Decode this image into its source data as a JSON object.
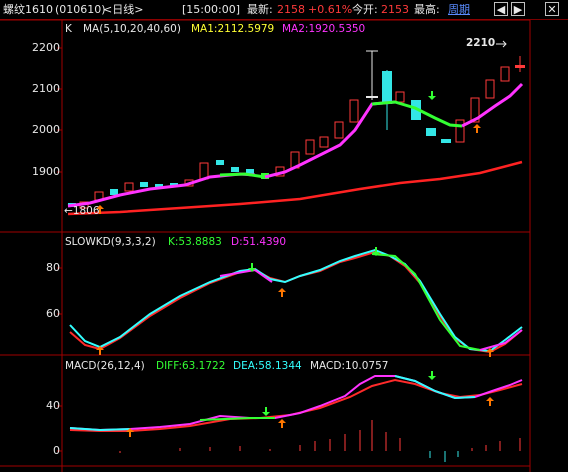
{
  "titlebar": {
    "symbol": "螺纹1610",
    "code": "(010610)",
    "period": "<日线>",
    "time": "[15:00:00]",
    "latest_label": "最新:",
    "latest_value": "2158",
    "change": "+0.61%",
    "open_label": "今开:",
    "open_value": "2153",
    "high_label": "最高:",
    "cycle_link": "周期",
    "buttons": [
      "◀",
      "▶",
      "✕"
    ]
  },
  "kline": {
    "label_k": "K",
    "ma_header": "MA(5,10,20,40,60)",
    "ma1": "MA1:2112.5979",
    "ma2": "MA2:1920.5350",
    "y_ticks": [
      "2200",
      "2100",
      "2000",
      "1900"
    ],
    "high_marker": "2210",
    "low_marker": "1806"
  },
  "kd": {
    "header": "SLOWKD(9,3,3,2)",
    "k": "K:53.8883",
    "d": "D:51.4390",
    "y_ticks": [
      "80",
      "60"
    ]
  },
  "macd": {
    "header": "MACD(26,12,4)",
    "diff": "DIFF:63.1722",
    "dea": "DEA:58.1344",
    "macd": "MACD:10.0757",
    "y_ticks": [
      "40",
      "0"
    ]
  },
  "colors": {
    "up": "#ff3a3a",
    "down": "#33e6e6",
    "ma_fast": "#ff33ff",
    "ma_flat": "#33ff33",
    "ma_slow": "#ff2222",
    "kd_k": "#33ffff",
    "kd_d": "#ff2a2a"
  }
}
